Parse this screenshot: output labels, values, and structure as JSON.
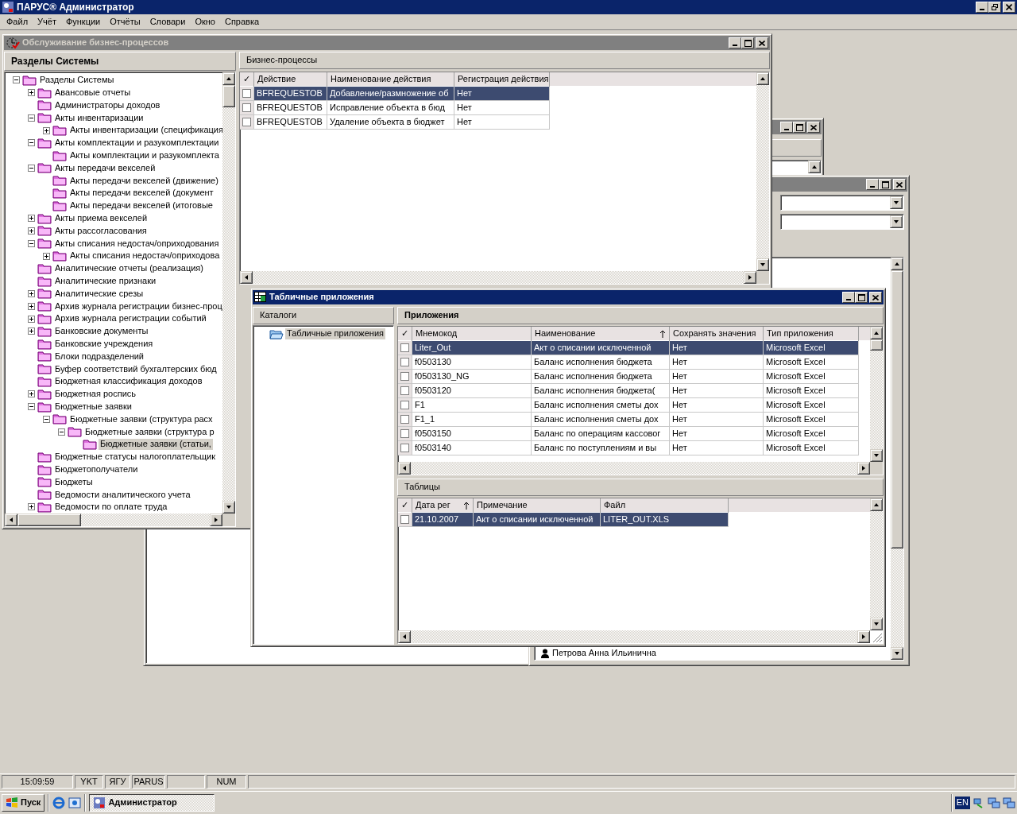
{
  "app": {
    "title": "ПАРУС® Администратор",
    "menu": [
      "Файл",
      "Учёт",
      "Функции",
      "Отчёты",
      "Словари",
      "Окно",
      "Справка"
    ]
  },
  "back_list": [
    "Петрова Анна Ильинична"
  ],
  "main_window": {
    "title": "Обслуживание бизнес-процессов",
    "active": false,
    "sections": {
      "header": "Разделы Системы",
      "tree": [
        {
          "label": "Разделы Системы",
          "selected": false,
          "expanded": true,
          "children": [
            {
              "label": "Авансовые отчеты",
              "selected": false,
              "expanded": false
            },
            {
              "label": "Администраторы доходов",
              "selected": false
            },
            {
              "label": "Акты инвентаризации",
              "selected": false,
              "expanded": true,
              "children": [
                {
                  "label": "Акты инвентаризации (спецификация",
                  "selected": false,
                  "expanded": false
                }
              ]
            },
            {
              "label": "Акты комплектации и разукомплектации",
              "selected": false,
              "expanded": true,
              "children": [
                {
                  "label": "Акты комплектации и разукомплекта",
                  "selected": false
                }
              ]
            },
            {
              "label": "Акты передачи векселей",
              "selected": false,
              "expanded": true,
              "children": [
                {
                  "label": "Акты передачи векселей (движение)",
                  "selected": false
                },
                {
                  "label": "Акты передачи векселей (документ",
                  "selected": false
                },
                {
                  "label": "Акты передачи векселей (итоговые",
                  "selected": false
                }
              ]
            },
            {
              "label": "Акты приема векселей",
              "selected": false,
              "expanded": false
            },
            {
              "label": "Акты рассогласования",
              "selected": false,
              "expanded": false
            },
            {
              "label": "Акты списания недостач/оприходования",
              "selected": false,
              "expanded": true,
              "children": [
                {
                  "label": "Акты списания недостач/оприходова",
                  "selected": false,
                  "expanded": false
                }
              ]
            },
            {
              "label": "Аналитические отчеты (реализация)",
              "selected": false
            },
            {
              "label": "Аналитические признаки",
              "selected": false
            },
            {
              "label": "Аналитические срезы",
              "selected": false,
              "expanded": false
            },
            {
              "label": "Архив журнала регистрации бизнес-проц",
              "selected": false,
              "expanded": false
            },
            {
              "label": "Архив журнала регистрации событий",
              "selected": false,
              "expanded": false
            },
            {
              "label": "Банковские документы",
              "selected": false,
              "expanded": false
            },
            {
              "label": "Банковские учреждения",
              "selected": false
            },
            {
              "label": "Блоки подразделений",
              "selected": false
            },
            {
              "label": "Буфер соответствий бухгалтерских бюд",
              "selected": false
            },
            {
              "label": "Бюджетная классификация доходов",
              "selected": false
            },
            {
              "label": "Бюджетная роспись",
              "selected": false,
              "expanded": false
            },
            {
              "label": "Бюджетные заявки",
              "selected": false,
              "expanded": true,
              "children": [
                {
                  "label": "Бюджетные заявки (структура расх",
                  "selected": false,
                  "expanded": true,
                  "children": [
                    {
                      "label": "Бюджетные заявки (структура р",
                      "selected": false,
                      "expanded": true,
                      "children": [
                        {
                          "label": "Бюджетные заявки (статьи,",
                          "selected": true
                        }
                      ]
                    }
                  ]
                }
              ]
            },
            {
              "label": "Бюджетные статусы налогоплательщик",
              "selected": false
            },
            {
              "label": "Бюджетополучатели",
              "selected": false
            },
            {
              "label": "Бюджеты",
              "selected": false
            },
            {
              "label": "Ведомости аналитического учета",
              "selected": false
            },
            {
              "label": "Ведомости по оплате труда",
              "selected": false,
              "expanded": false
            }
          ]
        }
      ]
    },
    "processes": {
      "header": "Бизнес-процессы",
      "check_header": "✓",
      "columns": [
        {
          "label": "Действие",
          "sorted": false
        },
        {
          "label": "Наименование действия",
          "sorted": false
        },
        {
          "label": "Регистрация действия",
          "sorted": false
        }
      ],
      "rows": [
        {
          "checked": false,
          "selected": true,
          "cells": [
            "BFREQUESTOB",
            "Добавление/размножение об",
            "Нет"
          ]
        },
        {
          "checked": false,
          "selected": false,
          "cells": [
            "BFREQUESTOB",
            "Исправление объекта в бюд",
            "Нет"
          ]
        },
        {
          "checked": false,
          "selected": false,
          "cells": [
            "BFREQUESTOB",
            "Удаление объекта в бюджет",
            "Нет"
          ]
        }
      ]
    }
  },
  "table_window": {
    "title": "Табличные приложения",
    "active": true,
    "catalogs": {
      "header": "Каталоги",
      "tree": [
        {
          "label": "Табличные приложения",
          "selected": true
        }
      ]
    },
    "apps": {
      "header": "Приложения",
      "check_header": "✓",
      "columns": [
        {
          "label": "Мнемокод",
          "sorted": false
        },
        {
          "label": "Наименование",
          "sorted": true
        },
        {
          "label": "Сохранять значения",
          "sorted": false
        },
        {
          "label": "Тип приложения",
          "sorted": false
        }
      ],
      "rows": [
        {
          "checked": false,
          "selected": true,
          "cells": [
            "Liter_Out",
            "Акт о списании исключенной",
            "Нет",
            "Microsoft Excel"
          ]
        },
        {
          "checked": false,
          "selected": false,
          "cells": [
            "f0503130",
            "Баланс исполнения бюджета",
            "Нет",
            "Microsoft Excel"
          ]
        },
        {
          "checked": false,
          "selected": false,
          "cells": [
            "f0503130_NG",
            "Баланс исполнения бюджета",
            "Нет",
            "Microsoft Excel"
          ]
        },
        {
          "checked": false,
          "selected": false,
          "cells": [
            "f0503120",
            "Баланс исполнения бюджета(",
            "Нет",
            "Microsoft Excel"
          ]
        },
        {
          "checked": false,
          "selected": false,
          "cells": [
            "F1",
            "Баланс исполнения сметы дох",
            "Нет",
            "Microsoft Excel"
          ]
        },
        {
          "checked": false,
          "selected": false,
          "cells": [
            "F1_1",
            "Баланс исполнения сметы дох",
            "Нет",
            "Microsoft Excel"
          ]
        },
        {
          "checked": false,
          "selected": false,
          "cells": [
            "f0503150",
            "Баланс по операциям кассовог",
            "Нет",
            "Microsoft Excel"
          ]
        },
        {
          "checked": false,
          "selected": false,
          "cells": [
            "f0503140",
            "Баланс по поступлениям и вы",
            "Нет",
            "Microsoft Excel"
          ]
        }
      ]
    },
    "tables": {
      "header": "Таблицы",
      "check_header": "✓",
      "columns": [
        {
          "label": "Дата рег",
          "sorted": true
        },
        {
          "label": "Примечание",
          "sorted": false
        },
        {
          "label": "Файл",
          "sorted": false
        }
      ],
      "rows": [
        {
          "checked": false,
          "selected": true,
          "cells": [
            "21.10.2007",
            "Акт о списании исключенной",
            "LITER_OUT.XLS"
          ]
        }
      ]
    }
  },
  "status_bar": [
    "15:09:59",
    "YKT",
    "ЯГУ",
    "PARUS",
    "NUM"
  ],
  "taskbar": {
    "start": "Пуск",
    "tasks": [
      {
        "label": "Администратор",
        "selected": true
      }
    ],
    "language": "EN"
  }
}
